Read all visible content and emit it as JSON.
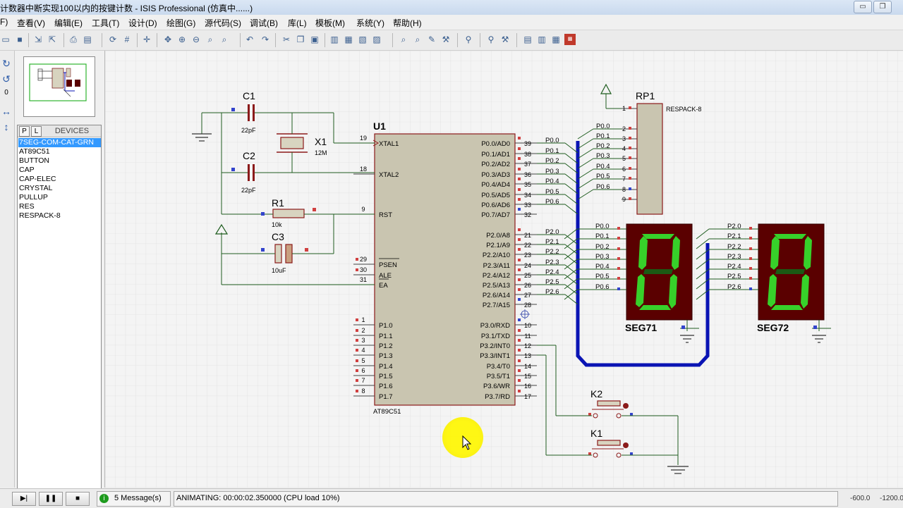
{
  "window": {
    "title": "计数器中断实现100以内的按键计数 - ISIS Professional (仿真中......)",
    "minimize_glyph": "▭",
    "restore_glyph": "❐"
  },
  "menu": [
    "F)",
    "查看(V)",
    "编辑(E)",
    "工具(T)",
    "设计(D)",
    "绘图(G)",
    "源代码(S)",
    "调试(B)",
    "库(L)",
    "模板(M)",
    "系统(Y)",
    "帮助(H)"
  ],
  "toolbar_icons": [
    "folder-icon",
    "save-icon",
    "import-icon",
    "export-icon",
    "print-icon",
    "page-icon",
    "refresh-icon",
    "grid-icon",
    "origin-icon",
    "pan-icon",
    "zoom-in-icon",
    "zoom-out-icon",
    "zoom-all-icon",
    "zoom-area-icon",
    "undo-icon",
    "redo-icon",
    "cut-icon",
    "copy-icon",
    "paste-icon",
    "block-copy-icon",
    "block-move-icon",
    "block-rotate-icon",
    "block-delete-icon",
    "pick-icon",
    "make-device-icon",
    "package-icon",
    "decompose-icon",
    "wire-autoroute-icon",
    "search-icon",
    "property-icon",
    "netlist-icon",
    "bom-icon",
    "erc-icon",
    "ares-icon"
  ],
  "left_tools": {
    "rotate_cw": "↻",
    "rotate_ccw": "↺",
    "angle": "0",
    "mirror_h": "↔",
    "mirror_v": "↕"
  },
  "device_panel": {
    "p_button": "P",
    "l_button": "L",
    "title": "DEVICES",
    "items": [
      "7SEG-COM-CAT-GRN",
      "AT89C51",
      "BUTTON",
      "CAP",
      "CAP-ELEC",
      "CRYSTAL",
      "PULLUP",
      "RES",
      "RESPACK-8"
    ],
    "selected_index": 0
  },
  "schematic": {
    "u1_ref": "U1",
    "u1_part": "AT89C51",
    "left_pins": [
      {
        "num": "19",
        "name": "XTAL1"
      },
      {
        "num": "18",
        "name": "XTAL2"
      },
      {
        "num": "9",
        "name": "RST"
      },
      {
        "num": "29",
        "name": "PSEN"
      },
      {
        "num": "30",
        "name": "ALE"
      },
      {
        "num": "31",
        "name": "EA"
      },
      {
        "num": "1",
        "name": "P1.0"
      },
      {
        "num": "2",
        "name": "P1.1"
      },
      {
        "num": "3",
        "name": "P1.2"
      },
      {
        "num": "4",
        "name": "P1.3"
      },
      {
        "num": "5",
        "name": "P1.4"
      },
      {
        "num": "6",
        "name": "P1.5"
      },
      {
        "num": "7",
        "name": "P1.6"
      },
      {
        "num": "8",
        "name": "P1.7"
      }
    ],
    "right_pins": [
      {
        "num": "39",
        "name": "P0.0/AD0"
      },
      {
        "num": "38",
        "name": "P0.1/AD1"
      },
      {
        "num": "37",
        "name": "P0.2/AD2"
      },
      {
        "num": "36",
        "name": "P0.3/AD3"
      },
      {
        "num": "35",
        "name": "P0.4/AD4"
      },
      {
        "num": "34",
        "name": "P0.5/AD5"
      },
      {
        "num": "33",
        "name": "P0.6/AD6"
      },
      {
        "num": "32",
        "name": "P0.7/AD7"
      },
      {
        "num": "21",
        "name": "P2.0/A8"
      },
      {
        "num": "22",
        "name": "P2.1/A9"
      },
      {
        "num": "23",
        "name": "P2.2/A10"
      },
      {
        "num": "24",
        "name": "P2.3/A11"
      },
      {
        "num": "25",
        "name": "P2.4/A12"
      },
      {
        "num": "26",
        "name": "P2.5/A13"
      },
      {
        "num": "27",
        "name": "P2.6/A14"
      },
      {
        "num": "28",
        "name": "P2.7/A15"
      },
      {
        "num": "10",
        "name": "P3.0/RXD"
      },
      {
        "num": "11",
        "name": "P3.1/TXD"
      },
      {
        "num": "12",
        "name": "P3.2/INT0"
      },
      {
        "num": "13",
        "name": "P3.3/INT1"
      },
      {
        "num": "14",
        "name": "P3.4/T0"
      },
      {
        "num": "15",
        "name": "P3.5/T1"
      },
      {
        "num": "16",
        "name": "P3.6/WR"
      },
      {
        "num": "17",
        "name": "P3.7/RD"
      }
    ],
    "p0_labels": [
      "P0.0",
      "P0.1",
      "P0.2",
      "P0.3",
      "P0.4",
      "P0.5",
      "P0.6"
    ],
    "p2_labels": [
      "P2.0",
      "P2.1",
      "P2.2",
      "P2.3",
      "P2.4",
      "P2.5",
      "P2.6"
    ],
    "rp1": {
      "ref": "RP1",
      "value": "RESPACK-8",
      "labels": [
        "P0.0",
        "P0.1",
        "P0.2",
        "P0.3",
        "P0.4",
        "P0.5",
        "P0.6"
      ],
      "pins": [
        "1",
        "2",
        "3",
        "4",
        "5",
        "6",
        "7",
        "8",
        "9"
      ]
    },
    "c1": {
      "ref": "C1",
      "value": "22pF"
    },
    "c2": {
      "ref": "C2",
      "value": "22pF"
    },
    "x1": {
      "ref": "X1",
      "value": "12M"
    },
    "r1": {
      "ref": "R1",
      "value": "10k"
    },
    "c3": {
      "ref": "C3",
      "value": "10uF"
    },
    "seg71": {
      "ref": "SEG71",
      "labels": [
        "P0.0",
        "P0.1",
        "P0.2",
        "P0.3",
        "P0.4",
        "P0.5",
        "P0.6"
      ]
    },
    "seg72": {
      "ref": "SEG72",
      "labels": [
        "P2.0",
        "P2.1",
        "P2.2",
        "P2.3",
        "P2.4",
        "P2.5",
        "P2.6"
      ]
    },
    "k2": {
      "ref": "K2"
    },
    "k1": {
      "ref": "K1"
    },
    "seg_color": "#37d12a",
    "seg_bg": "#5a0000",
    "bus_color": "#0a14b4",
    "wire_color": "#1f5d1f",
    "chip_fill": "#c9c5b0",
    "chip_border": "#8b1a1a"
  },
  "status": {
    "play": "▶|",
    "step": "▶",
    "pause": "❚❚",
    "stop": "■",
    "messages": "5 Message(s)",
    "animating": "ANIMATING: 00:00:02.350000 (CPU load 10%)",
    "coord_x": "-600.0",
    "coord_y": "-1200.0"
  }
}
